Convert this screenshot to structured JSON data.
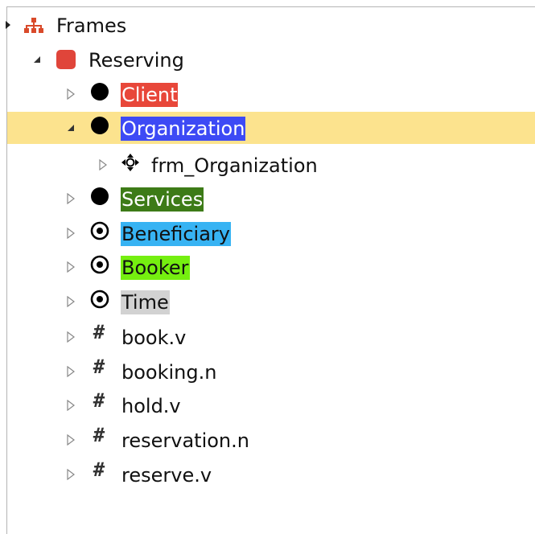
{
  "tree": {
    "root": {
      "label": "Frames",
      "icon": "sitemap-icon",
      "icon_color": "#d94a2a",
      "expanded": true
    },
    "frame": {
      "label": "Reserving",
      "icon": "red-square-icon",
      "icon_color": "#e0453a",
      "expanded": true
    },
    "elements": [
      {
        "label": "Client",
        "icon": "filled-circle-icon",
        "highlight": "#e8473a",
        "expanded": false
      },
      {
        "label": "Organization",
        "icon": "filled-circle-icon",
        "highlight": "#3d4af5",
        "expanded": true,
        "selected": true,
        "children": [
          {
            "label": "frm_Organization",
            "icon": "crosshair-icon",
            "expanded": false
          }
        ]
      },
      {
        "label": "Services",
        "icon": "filled-circle-icon",
        "highlight": "#3d7b17",
        "expanded": false
      },
      {
        "label": "Beneficiary",
        "icon": "target-circle-icon",
        "highlight": "#37b3f3",
        "expanded": false
      },
      {
        "label": "Booker",
        "icon": "target-circle-icon",
        "highlight": "#75ef10",
        "expanded": false
      },
      {
        "label": "Time",
        "icon": "target-circle-icon",
        "highlight": "#d2d2d2",
        "expanded": false
      }
    ],
    "lexical_units": [
      {
        "label": "book.v",
        "icon": "hash-icon"
      },
      {
        "label": "booking.n",
        "icon": "hash-icon"
      },
      {
        "label": "hold.v",
        "icon": "hash-icon"
      },
      {
        "label": "reservation.n",
        "icon": "hash-icon"
      },
      {
        "label": "reserve.v",
        "icon": "hash-icon"
      }
    ],
    "hash_glyph": "#",
    "selection_color": "#fce38e"
  }
}
